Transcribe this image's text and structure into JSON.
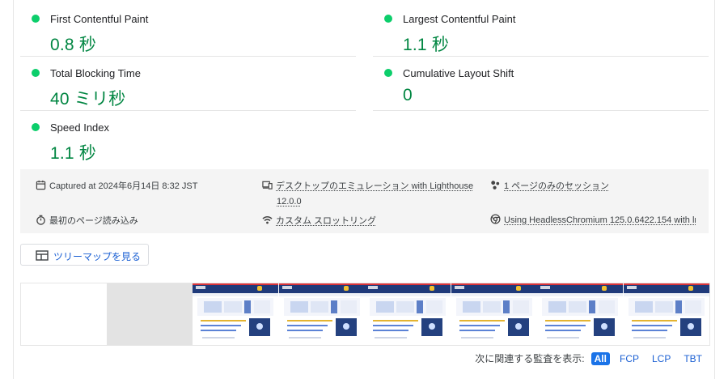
{
  "metrics": [
    {
      "label": "First Contentful Paint",
      "value": "0.8 秒"
    },
    {
      "label": "Largest Contentful Paint",
      "value": "1.1 秒"
    },
    {
      "label": "Total Blocking Time",
      "value": "40 ミリ秒"
    },
    {
      "label": "Cumulative Layout Shift",
      "value": "0"
    },
    {
      "label": "Speed Index",
      "value": "1.1 秒"
    }
  ],
  "metric_status_color": "#0cce6b",
  "metric_value_color": "#018642",
  "info": {
    "captured": "Captured at 2024年6月14日 8:32 JST",
    "emulation": "デスクトップのエミュレーション with Lighthouse",
    "emulation_version": "12.0.0",
    "session": "1 ページのみのセッション",
    "load": "最初のページ読み込み",
    "throttling": "カスタム スロットリング",
    "browser": "Using HeadlessChromium 125.0.6422.154 with lr"
  },
  "treemap_button": "ツリーマップを見る",
  "audits": {
    "label": "次に関連する監査を表示:",
    "filters": [
      "All",
      "FCP",
      "LCP",
      "TBT"
    ],
    "active": "All"
  },
  "icons": {
    "captured": "calendar-icon",
    "emulation": "devices-icon",
    "session": "session-icon",
    "load": "timer-icon",
    "throttling": "wifi-icon",
    "browser": "chrome-icon",
    "treemap": "treemap-icon"
  }
}
